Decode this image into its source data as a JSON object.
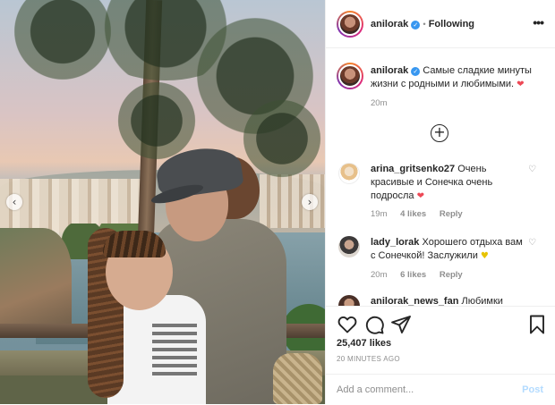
{
  "post": {
    "author": "anilorak",
    "follow_status": "Following",
    "separator": "•",
    "more_icon": "ellipsis-icon",
    "caption": "Самые сладкие минуты жизни с родными и любимыми.",
    "caption_emoji": "❤",
    "caption_time": "20m",
    "load_more_icon": "plus-circle-icon",
    "likes": "25,407 likes",
    "time_ago": "20 MINUTES AGO"
  },
  "comments": [
    {
      "user": "arina_gritsenko27",
      "text": "Очень красивые и Сонечка очень подросла",
      "emoji": "❤",
      "time": "19m",
      "likes": "4 likes",
      "reply": "Reply"
    },
    {
      "user": "lady_lorak",
      "text": "Хорошего отдыха вам с Сонечкой! Заслужили",
      "emoji": "💛",
      "time": "20m",
      "likes": "6 likes",
      "reply": "Reply"
    },
    {
      "user": "anilorak_news_fan",
      "text": "Любимки"
    }
  ],
  "actions": {
    "like_icon": "heart-icon",
    "comment_icon": "comment-icon",
    "share_icon": "share-icon",
    "save_icon": "bookmark-icon"
  },
  "composer": {
    "placeholder": "Add a comment...",
    "post_label": "Post"
  },
  "colors": {
    "verified": "#3897f0",
    "post_button_disabled": "#b3dbff",
    "secondary_text": "#8e8e8e",
    "heart_red": "#ed4956"
  }
}
